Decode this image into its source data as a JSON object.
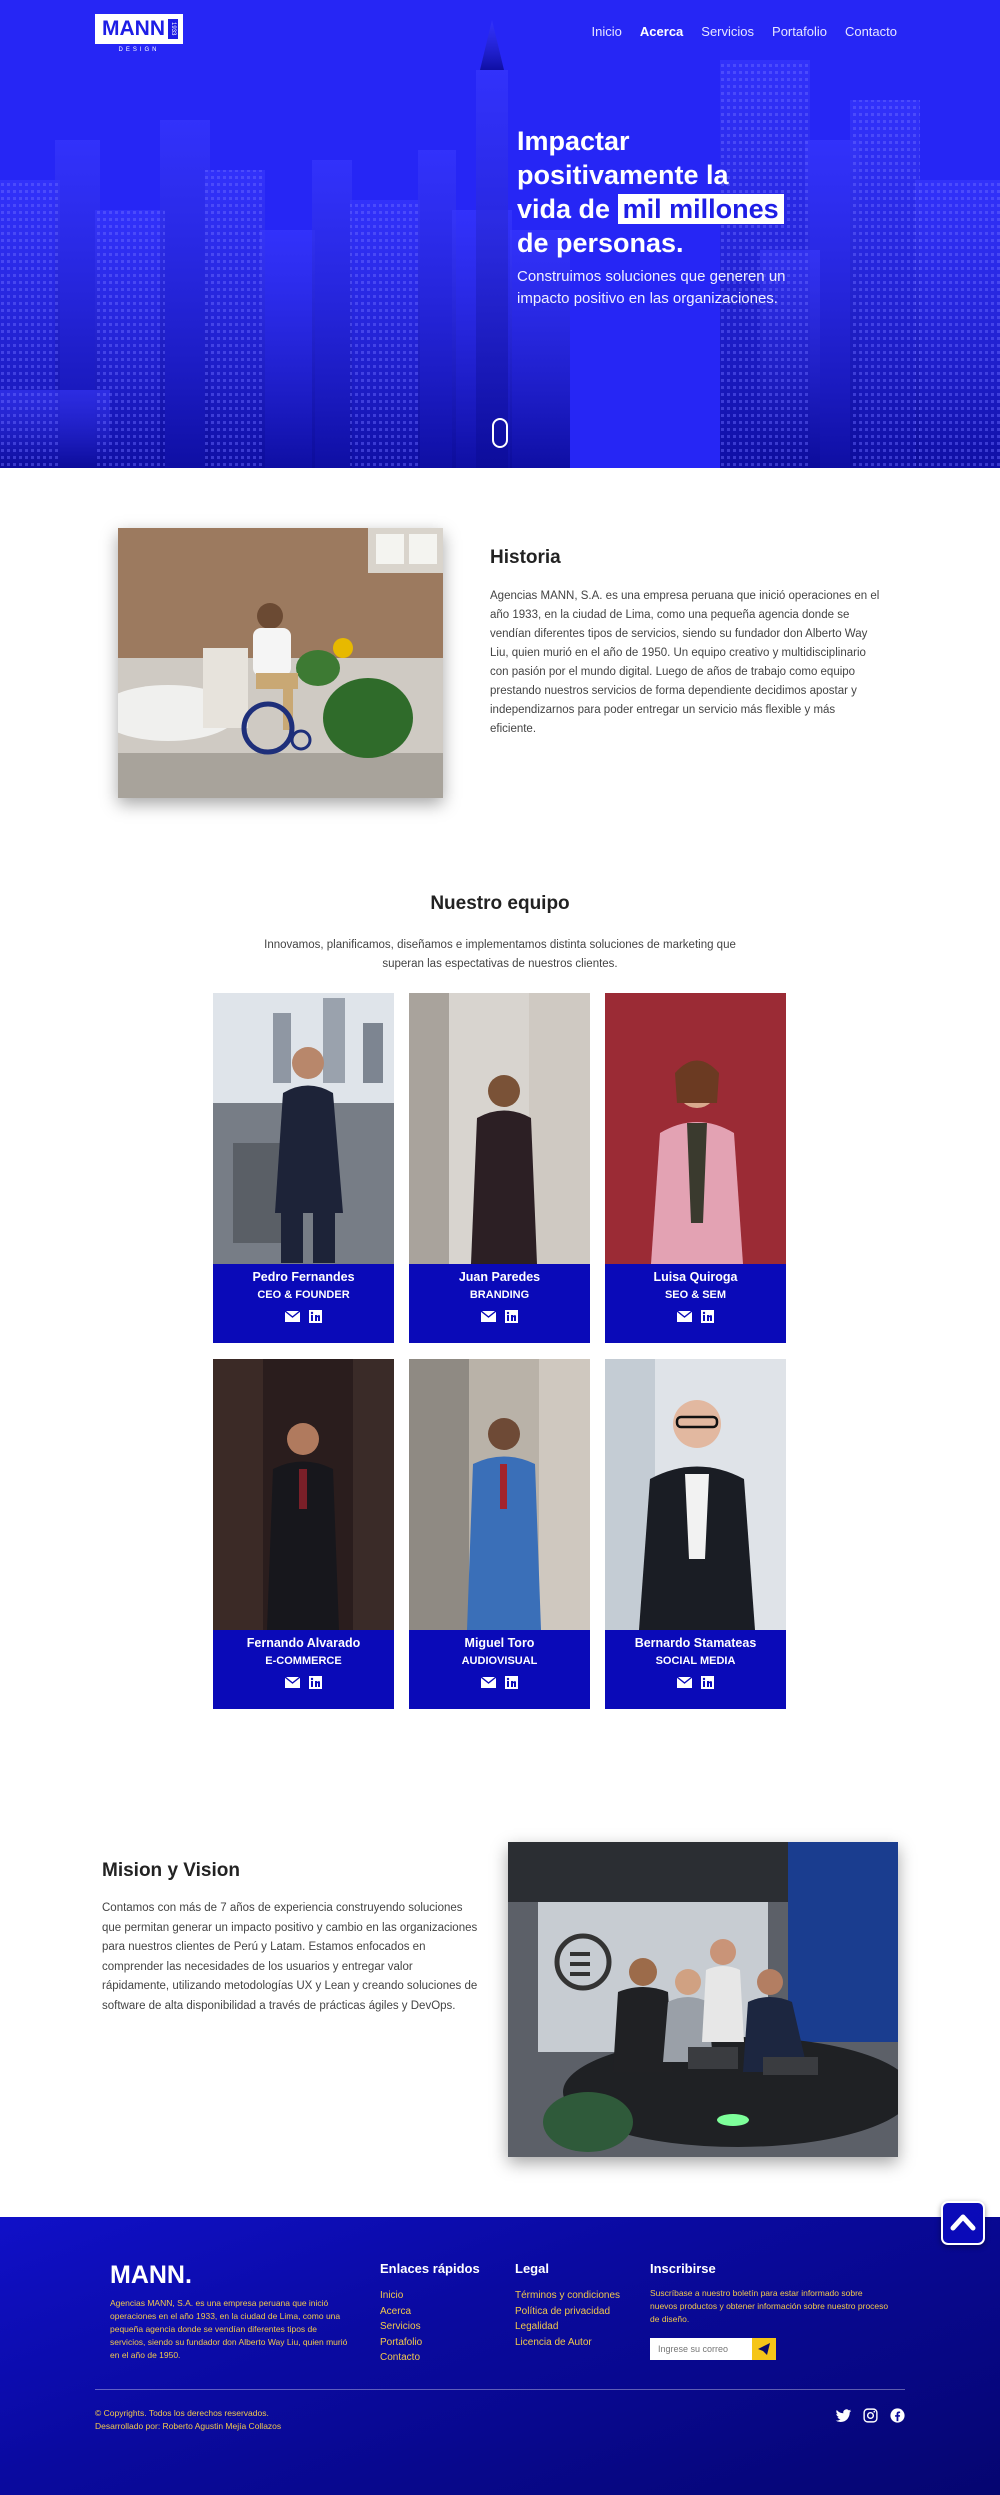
{
  "brand": {
    "logo_text": "MANN",
    "logo_badge": "1933",
    "logo_sub": "DESIGN"
  },
  "nav": {
    "items": [
      {
        "label": "Inicio",
        "active": false
      },
      {
        "label": "Acerca",
        "active": true
      },
      {
        "label": "Servicios",
        "active": false
      },
      {
        "label": "Portafolio",
        "active": false
      },
      {
        "label": "Contacto",
        "active": false
      }
    ]
  },
  "hero": {
    "title_line1": "Impactar",
    "title_line2": "positivamente la",
    "title_line3_pre": "vida de",
    "title_highlight": "mil millones",
    "title_line4": "de personas.",
    "subtitle": "Construimos soluciones que generen un impacto positivo en las organizaciones."
  },
  "historia": {
    "title": "Historia",
    "text": "Agencias MANN, S.A. es una empresa peruana que inició operaciones en el año 1933, en la ciudad de Lima, como una pequeña agencia donde se vendían diferentes tipos de servicios, siendo su fundador don Alberto Way Liu, quien murió en el año de 1950. Un equipo creativo y multidisciplinario con pasión por el mundo digital. Luego de años de trabajo como equipo prestando nuestros servicios de forma dependiente decidimos apostar y independizarnos para poder entregar un servicio más flexible y más eficiente."
  },
  "equipo": {
    "title": "Nuestro equipo",
    "subtitle": "Innovamos, planificamos, diseñamos e implementamos distinta soluciones de marketing que superan las espectativas de nuestros clientes.",
    "members": [
      {
        "name": "Pedro Fernandes",
        "role": "CEO & FOUNDER"
      },
      {
        "name": "Juan Paredes",
        "role": "BRANDING"
      },
      {
        "name": "Luisa Quiroga",
        "role": "SEO & SEM"
      },
      {
        "name": "Fernando Alvarado",
        "role": "E-COMMERCE"
      },
      {
        "name": "Miguel Toro",
        "role": "AUDIOVISUAL"
      },
      {
        "name": "Bernardo Stamateas",
        "role": "SOCIAL MEDIA"
      }
    ]
  },
  "mision": {
    "title": "Mision y Vision",
    "text": "Contamos con más de 7 años de experiencia construyendo soluciones que permitan generar un impacto positivo y cambio en las organizaciones para nuestros clientes de Perú y Latam. Estamos enfocados en comprender las necesidades de los usuarios y entregar valor rápidamente, utilizando metodologías UX y Lean y creando soluciones de software de alta disponibilidad a través de prácticas ágiles y DevOps."
  },
  "footer": {
    "logo": "MANN.",
    "about": "Agencias MANN, S.A. es una empresa peruana que inició operaciones en el año 1933, en la ciudad de Lima, como una pequeña agencia donde se vendían diferentes tipos de servicios, siendo su fundador don Alberto Way Liu, quien murió en el año de 1950.",
    "quick_title": "Enlaces rápidos",
    "quick_links": [
      "Inicio",
      "Acerca",
      "Servicios",
      "Portafolio",
      "Contacto"
    ],
    "legal_title": "Legal",
    "legal_links": [
      "Términos y condiciones",
      "Política de privacidad",
      "Legalidad",
      "Licencia de Autor"
    ],
    "subscribe_title": "Inscribirse",
    "subscribe_text": "Suscríbase a nuestro boletín para estar informado sobre nuevos productos y obtener información sobre nuestro proceso de diseño.",
    "email_placeholder": "Ingrese su correo",
    "copyright": "© Copyrights. Todos los derechos reservados.",
    "developer": "Desarrollado por: Roberto Agustin Mejía Collazos"
  },
  "colors": {
    "brand_blue": "#1e1ee6",
    "card_blue": "#0a0ab8",
    "footer_text": "#f2c94c"
  }
}
